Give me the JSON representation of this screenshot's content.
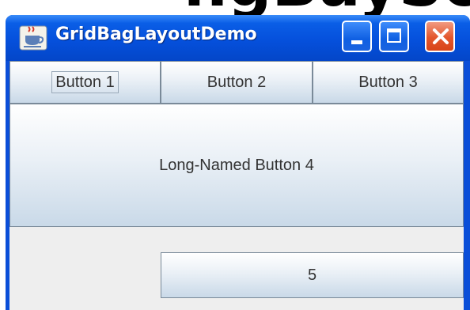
{
  "background_fragment": "ngBaySo",
  "window": {
    "title": "GridBagLayoutDemo",
    "icon": "java-cup-icon",
    "controls": {
      "minimize": "minimize-icon",
      "maximize": "maximize-icon",
      "close": "close-icon"
    }
  },
  "buttons": {
    "button1": "Button 1",
    "button2": "Button 2",
    "button3": "Button 3",
    "button4": "Long-Named Button 4",
    "button5": "5"
  },
  "colors": {
    "titlebar": "#0550dc",
    "close": "#e3562c",
    "content_bg": "#eeeeee",
    "button_text": "#333333"
  }
}
